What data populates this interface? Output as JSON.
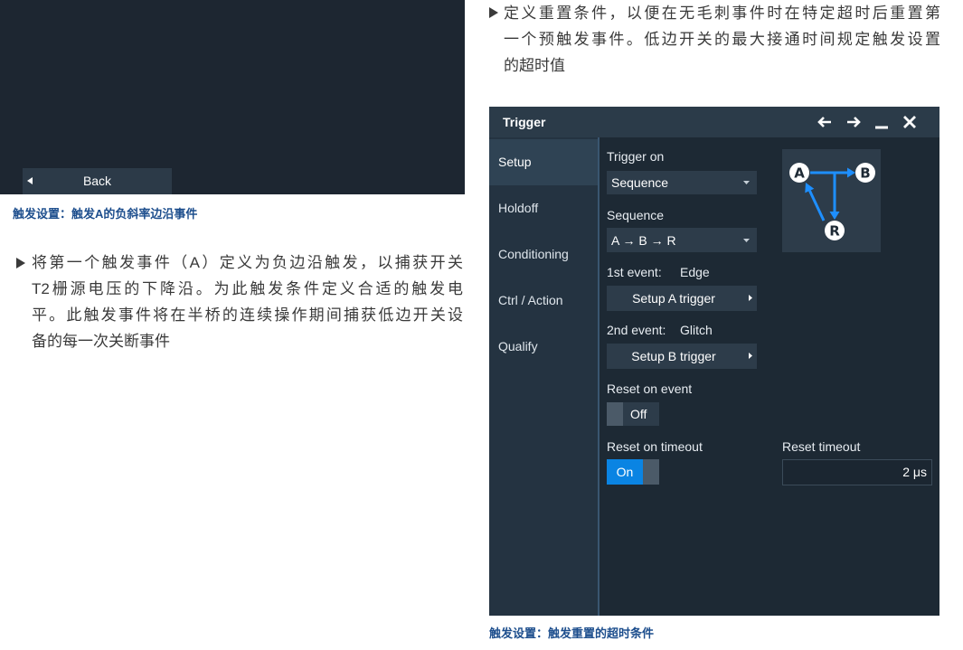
{
  "colors": {
    "caption_blue": "#1d4e8d",
    "toggle_on_blue": "#0a84e3",
    "diagram_arrow_blue": "#1e8fff"
  },
  "left_panel": {
    "back_button": {
      "icon": "caret-left-icon",
      "label": "Back"
    },
    "caption": "触发设置：触发A的负斜率边沿事件"
  },
  "left_bullet": {
    "marker_icon": "bullet-triangle-icon",
    "lines": [
      "将第一个触发事件（A）定义为负边沿触发，以捕获开关",
      "T2栅源电压的下降沿。为此触发条件定义合适的触发电",
      "平。此触发事件将在半桥的连续操作期间捕获低边开关设",
      "备的每一次关断事件"
    ]
  },
  "right_bullet": {
    "marker_icon": "bullet-triangle-icon",
    "lines": [
      "定义重置条件，以便在无毛刺事件时在特定超时后重置第",
      "一个预触发事件。低边开关的最大接通时间规定触发设置",
      "的超时值"
    ]
  },
  "trigger_dialog": {
    "title": "Trigger",
    "title_icons": [
      "arrow-left-icon",
      "arrow-right-icon",
      "minimize-icon",
      "close-icon"
    ],
    "tabs": [
      {
        "label": "Setup",
        "selected": true
      },
      {
        "label": "Holdoff",
        "selected": false
      },
      {
        "label": "Conditioning",
        "selected": false
      },
      {
        "label": "Ctrl / Action",
        "selected": false
      },
      {
        "label": "Qualify",
        "selected": false
      }
    ],
    "trigger_on": {
      "label": "Trigger on",
      "value": "Sequence",
      "icon": "caret-down-icon"
    },
    "sequence": {
      "label": "Sequence",
      "value": "A → B → R",
      "icon": "caret-down-icon"
    },
    "first_event": {
      "label": "1st event:",
      "value": "Edge",
      "button": "Setup A trigger",
      "icon": "caret-right-icon"
    },
    "second_event": {
      "label": "2nd event:",
      "value": "Glitch",
      "button": "Setup B trigger",
      "icon": "caret-right-icon"
    },
    "reset_on_event": {
      "label": "Reset on event",
      "state": "Off",
      "on": false
    },
    "reset_on_timeout": {
      "label": "Reset on timeout",
      "state": "On",
      "on": true
    },
    "reset_timeout": {
      "label": "Reset timeout",
      "value": "2 μs"
    },
    "sequence_diagram": {
      "nodes": {
        "a": "A",
        "b": "B",
        "r": "R"
      }
    }
  },
  "right_caption": "触发设置：触发重置的超时条件"
}
